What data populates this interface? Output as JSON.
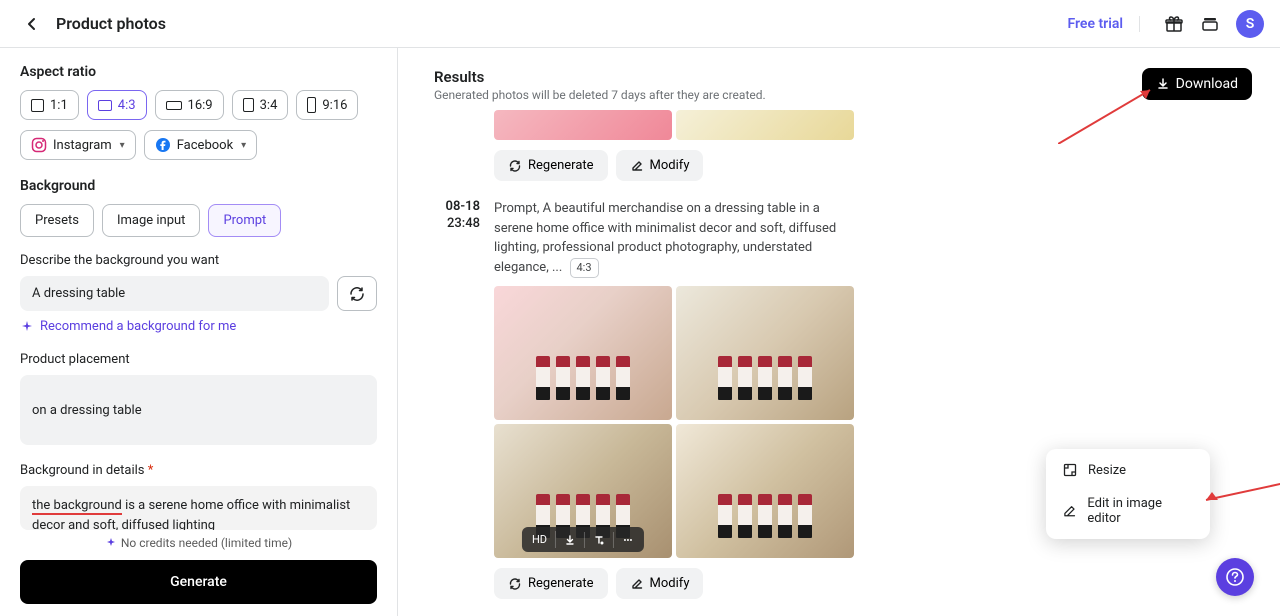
{
  "header": {
    "title": "Product photos",
    "free_trial": "Free trial",
    "avatar_initial": "S"
  },
  "sidebar": {
    "aspect_ratio_label": "Aspect ratio",
    "ratios": [
      "1:1",
      "4:3",
      "16:9",
      "3:4",
      "9:16"
    ],
    "social": {
      "instagram": "Instagram",
      "facebook": "Facebook"
    },
    "background_label": "Background",
    "bg_tabs": {
      "presets": "Presets",
      "image_input": "Image input",
      "prompt": "Prompt"
    },
    "describe_label": "Describe the background you want",
    "describe_value": "A dressing table",
    "recommend": "Recommend a background for me",
    "placement_label": "Product placement",
    "placement_value": "on a dressing table",
    "details_label": "Background in details",
    "details_prefix": "the background",
    "details_rest": " is a serene home office with minimalist decor and soft, diffused lighting",
    "credits_note": "No credits needed (limited time)",
    "generate": "Generate"
  },
  "results": {
    "title": "Results",
    "subtitle": "Generated photos will be deleted 7 days after they are created.",
    "download": "Download",
    "blocks": [
      {
        "date": "08-18",
        "time": "23:48",
        "prompt": "Prompt, A beautiful merchandise on a dressing table in a serene home office with minimalist decor and soft, diffused lighting, professional product photography, understated elegance, ...",
        "ratio_badge": "4:3"
      }
    ],
    "actions": {
      "regenerate": "Regenerate",
      "modify": "Modify"
    },
    "thumb_overlay": {
      "hd": "HD"
    }
  },
  "popover": {
    "resize": "Resize",
    "edit": "Edit in image editor"
  }
}
